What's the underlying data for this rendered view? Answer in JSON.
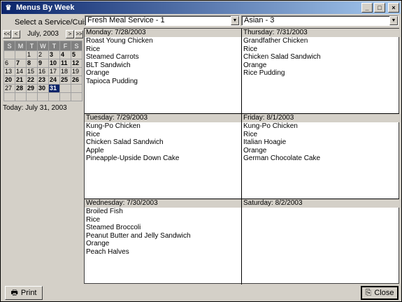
{
  "window": {
    "title": "Menus By Week",
    "app_icon": "chef-hat-icon"
  },
  "controls": {
    "minimize": "_",
    "maximize": "□",
    "close": "×"
  },
  "filters": {
    "label": "Select a Service/Cuisine:",
    "service": "Fresh Meal Service - 1",
    "cuisine": "Asian - 3"
  },
  "calendar": {
    "nav": {
      "prev_year": "<<",
      "prev_month": "<",
      "next_month": ">",
      "next_year": ">>"
    },
    "month_label": "July, 2003",
    "weekdays": [
      "S",
      "M",
      "T",
      "W",
      "T",
      "F",
      "S"
    ],
    "weeks": [
      [
        "",
        "",
        "1",
        "2",
        "3",
        "4",
        "5"
      ],
      [
        "6",
        "7",
        "8",
        "9",
        "10",
        "11",
        "12"
      ],
      [
        "13",
        "14",
        "15",
        "16",
        "17",
        "18",
        "19"
      ],
      [
        "20",
        "21",
        "22",
        "23",
        "24",
        "25",
        "26"
      ],
      [
        "27",
        "28",
        "29",
        "30",
        "31",
        "",
        ""
      ],
      [
        "",
        "",
        "",
        "",
        "",
        "",
        ""
      ]
    ],
    "bold_days": [
      "3",
      "4",
      "5",
      "7",
      "8",
      "9",
      "10",
      "11",
      "12",
      "20",
      "21",
      "22",
      "23",
      "24",
      "25",
      "26",
      "28",
      "29",
      "30"
    ],
    "selected_day": "31",
    "today_text": "Today: July 31, 2003"
  },
  "days": [
    {
      "header": "Monday:  7/28/2003",
      "items": [
        "Roast Young Chicken",
        "Rice",
        "Steamed Carrots",
        "BLT Sandwich",
        "Orange",
        "Tapioca Pudding"
      ]
    },
    {
      "header": "Thursday:  7/31/2003",
      "items": [
        "Grandfather Chicken",
        "Rice",
        "Chicken Salad Sandwich",
        "Orange",
        "Rice Pudding"
      ]
    },
    {
      "header": "Tuesday:  7/29/2003",
      "items": [
        "Kung-Po Chicken",
        "Rice",
        "Chicken Salad Sandwich",
        "Apple",
        "Pineapple-Upside Down Cake"
      ]
    },
    {
      "header": "Friday:  8/1/2003",
      "items": [
        "Kung-Po Chicken",
        "Rice",
        "Italian Hoagie",
        "Orange",
        "German Chocolate Cake"
      ]
    },
    {
      "header": "Wednesday:  7/30/2003",
      "items": [
        "Broiled Fish",
        "Rice",
        "Steamed Broccoli",
        "Peanut Butter and Jelly Sandwich",
        "Orange",
        "Peach Halves"
      ]
    },
    {
      "header": "Saturday:  8/2/2003",
      "items": []
    }
  ],
  "buttons": {
    "print": "Print",
    "close": "Close"
  }
}
